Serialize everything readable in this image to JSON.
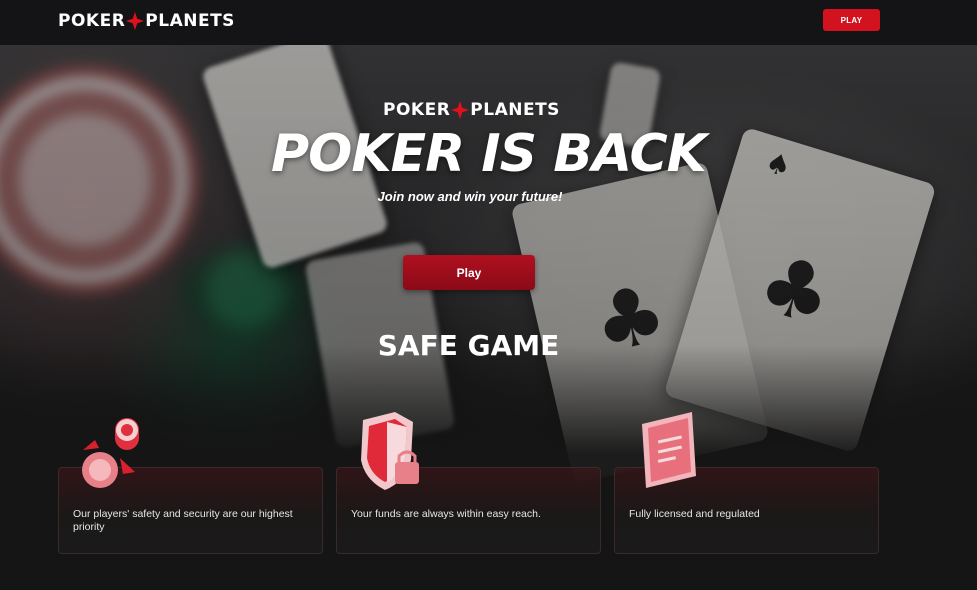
{
  "header": {
    "logo_part1": "POKER",
    "logo_part2": "PLANETS",
    "play_label": "PLAY"
  },
  "hero": {
    "logo_part1": "POKER",
    "logo_part2": "PLANETS",
    "title": "POKER IS BACK",
    "subtitle": "Join now and win your future!",
    "play_label": "Play"
  },
  "safe_game": {
    "title": "SAFE GAME",
    "features": [
      {
        "icon": "chips-exchange-icon",
        "text": "Our players' safety and security are our highest priority"
      },
      {
        "icon": "shield-lock-icon",
        "text": "Your funds are always within easy reach."
      },
      {
        "icon": "license-certificate-icon",
        "text": "Fully licensed and regulated"
      }
    ]
  },
  "colors": {
    "accent": "#d3121f",
    "background": "#151515",
    "header_bg": "#141416"
  }
}
